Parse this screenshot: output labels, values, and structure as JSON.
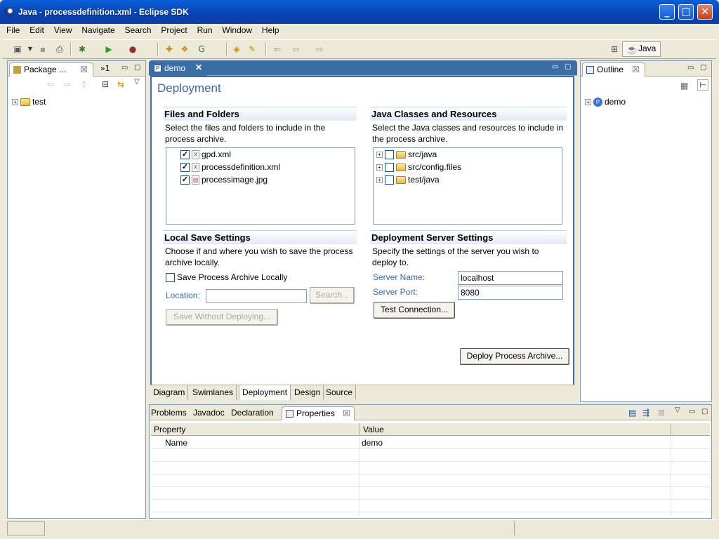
{
  "window": {
    "title": "Java - processdefinition.xml - Eclipse SDK"
  },
  "menu": [
    "File",
    "Edit",
    "View",
    "Navigate",
    "Search",
    "Project",
    "Run",
    "Window",
    "Help"
  ],
  "perspective": {
    "label": "Java"
  },
  "package_explorer": {
    "tab_label": "Package ...",
    "overflow_label": "»1",
    "tree": [
      {
        "label": "test"
      }
    ]
  },
  "editor": {
    "tab_label": "demo",
    "heading": "Deployment",
    "files": {
      "title": "Files and Folders",
      "description": "Select the files and folders to include in the process archive.",
      "items": [
        {
          "label": "gpd.xml",
          "checked": true
        },
        {
          "label": "processdefinition.xml",
          "checked": true
        },
        {
          "label": "processimage.jpg",
          "checked": true
        }
      ]
    },
    "java": {
      "title": "Java Classes and Resources",
      "description": "Select the Java classes and resources to include in the process archive.",
      "items": [
        {
          "label": "src/java",
          "checked": false
        },
        {
          "label": "src/config.files",
          "checked": false
        },
        {
          "label": "test/java",
          "checked": false
        }
      ]
    },
    "local_save": {
      "title": "Local Save Settings",
      "description": "Choose if and where you wish to save the process archive locally.",
      "checkbox_label": "Save Process Archive Locally",
      "location_label": "Location:",
      "location_value": "",
      "search_button": "Search...",
      "save_button": "Save Without Deploying..."
    },
    "server": {
      "title": "Deployment Server Settings",
      "description": "Specify the settings of the server you wish to deploy to.",
      "name_label": "Server Name:",
      "name_value": "localhost",
      "port_label": "Server Port:",
      "port_value": "8080",
      "test_button": "Test Connection..."
    },
    "deploy_button": "Deploy Process Archive...",
    "bottom_tabs": [
      "Diagram",
      "Swimlanes",
      "Deployment",
      "Design",
      "Source"
    ]
  },
  "outline": {
    "tab_label": "Outline",
    "tree": [
      {
        "label": "demo"
      }
    ]
  },
  "bottom_panel": {
    "tabs": [
      "Problems",
      "Javadoc",
      "Declaration",
      "Properties"
    ],
    "columns": [
      "Property",
      "Value"
    ],
    "rows": [
      {
        "property": "Name",
        "value": "demo"
      }
    ]
  },
  "colors": {
    "title_bar": "#0842b0",
    "accent": "#3868b4"
  }
}
